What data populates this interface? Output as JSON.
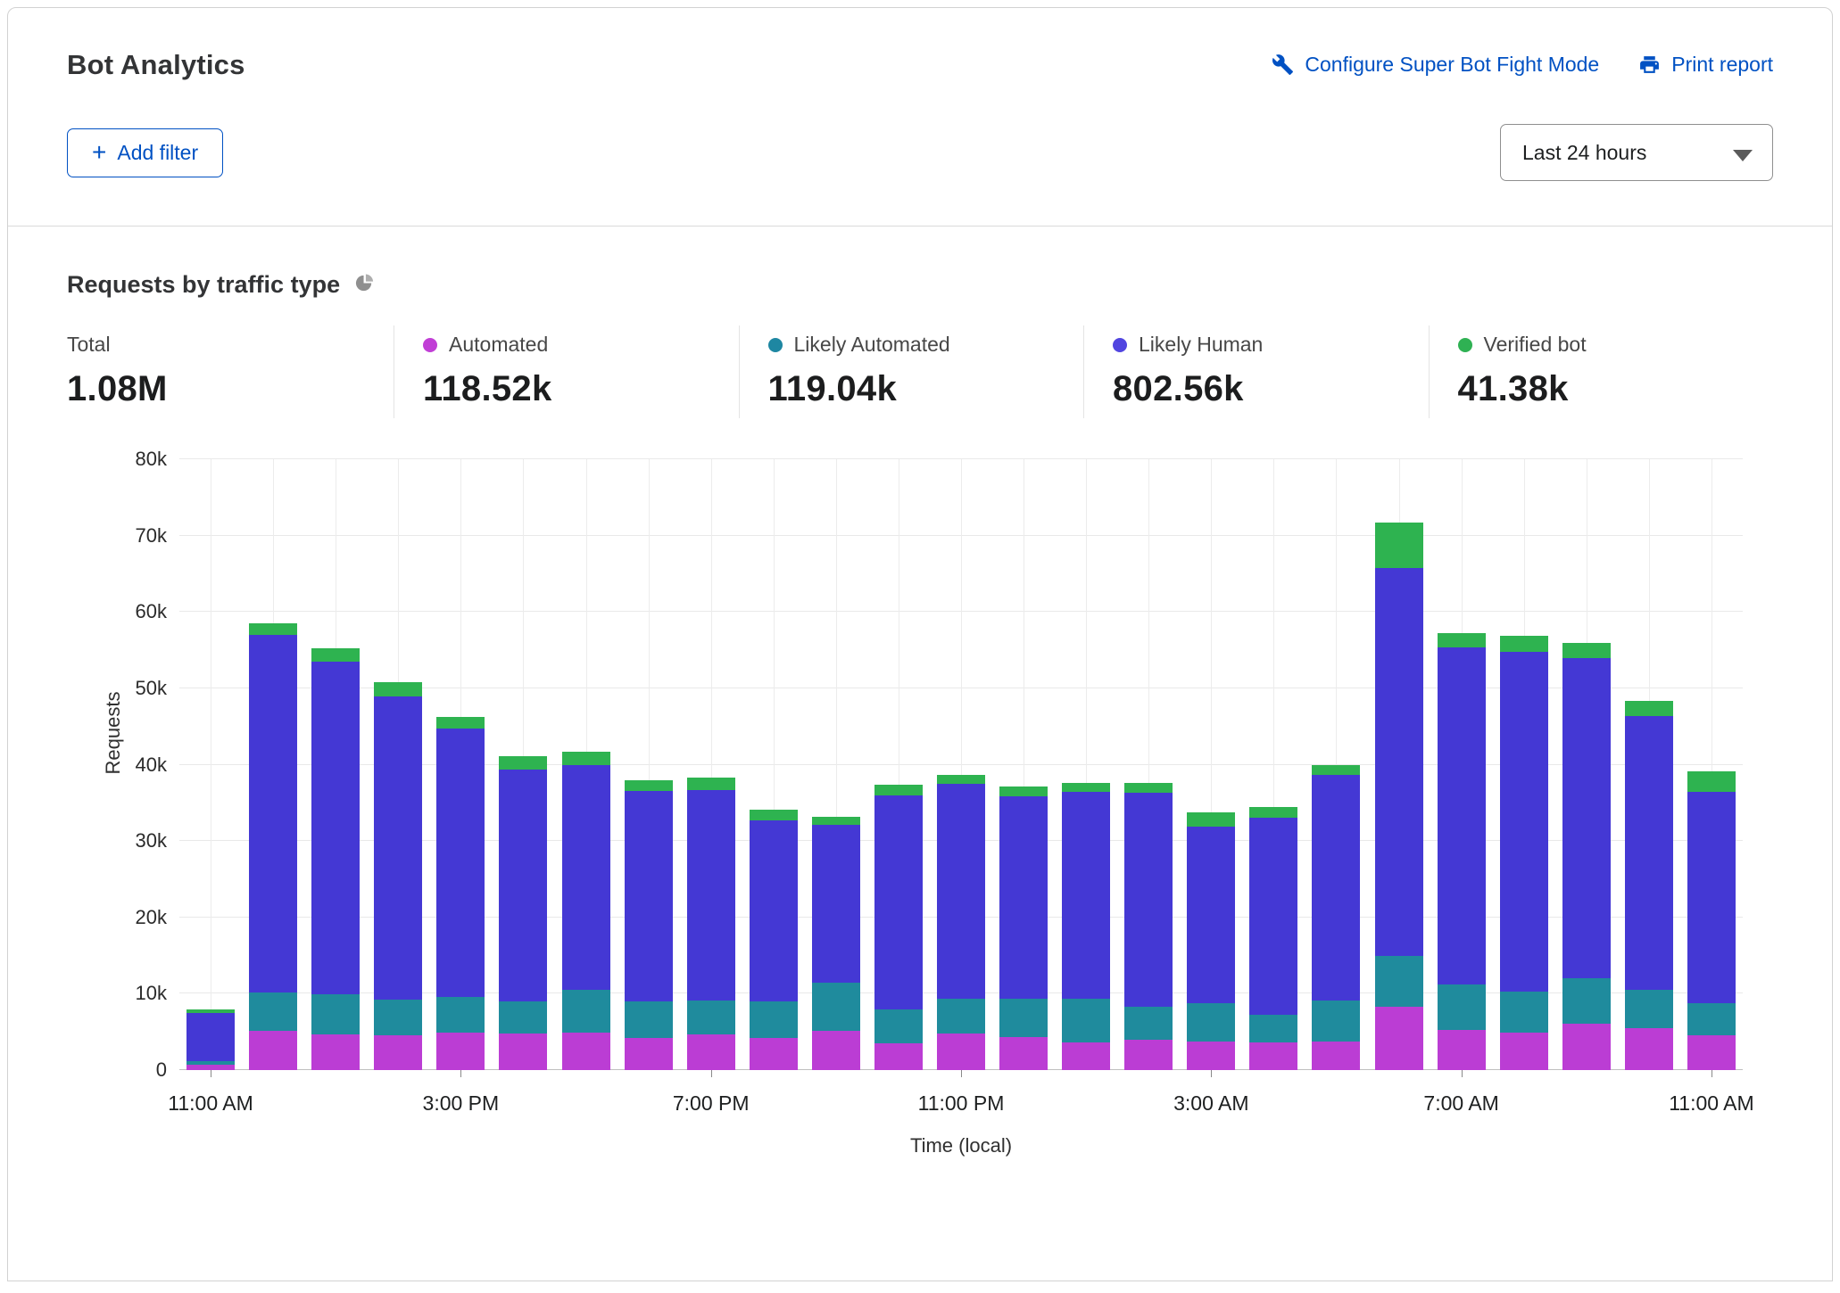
{
  "header": {
    "title": "Bot Analytics",
    "configure_link": "Configure Super Bot Fight Mode",
    "print_link": "Print report",
    "add_filter_plus": "+",
    "add_filter_label": "Add filter",
    "time_range_value": "Last 24 hours"
  },
  "section": {
    "title": "Requests by traffic type"
  },
  "stats": [
    {
      "label": "Total",
      "value": "1.08M",
      "color": ""
    },
    {
      "label": "Automated",
      "value": "118.52k",
      "color": "#c13fd6"
    },
    {
      "label": "Likely Automated",
      "value": "119.04k",
      "color": "#1e87a2"
    },
    {
      "label": "Likely Human",
      "value": "802.56k",
      "color": "#5145e0"
    },
    {
      "label": "Verified bot",
      "value": "41.38k",
      "color": "#2fb153"
    }
  ],
  "colors": {
    "link_blue": "#0051c3",
    "grid": "#e9e9e9",
    "axis": "#bfbfbf"
  },
  "chart_data": {
    "type": "bar",
    "stacked": true,
    "title": "Requests by traffic type",
    "xlabel": "Time (local)",
    "ylabel": "Requests",
    "ylim": [
      0,
      80000
    ],
    "grid": true,
    "legend_position": "top-stats-row",
    "y_ticks": [
      "0",
      "10k",
      "20k",
      "30k",
      "40k",
      "50k",
      "60k",
      "70k",
      "80k"
    ],
    "x_ticks": [
      {
        "index": 0,
        "label": "11:00 AM"
      },
      {
        "index": 4,
        "label": "3:00 PM"
      },
      {
        "index": 8,
        "label": "7:00 PM"
      },
      {
        "index": 12,
        "label": "11:00 PM"
      },
      {
        "index": 16,
        "label": "3:00 AM"
      },
      {
        "index": 20,
        "label": "7:00 AM"
      },
      {
        "index": 24,
        "label": "11:00 AM"
      }
    ],
    "categories": [
      "11:00 AM",
      "12:00 PM",
      "1:00 PM",
      "2:00 PM",
      "3:00 PM",
      "4:00 PM",
      "5:00 PM",
      "6:00 PM",
      "7:00 PM",
      "8:00 PM",
      "9:00 PM",
      "10:00 PM",
      "11:00 PM",
      "12:00 AM",
      "1:00 AM",
      "2:00 AM",
      "3:00 AM",
      "4:00 AM",
      "5:00 AM",
      "6:00 AM",
      "7:00 AM",
      "8:00 AM",
      "9:00 AM",
      "10:00 AM",
      "11:00 AM"
    ],
    "series": [
      {
        "name": "Automated",
        "color": "#bb3dd4",
        "values": [
          700,
          5100,
          4700,
          4600,
          4900,
          4800,
          4900,
          4200,
          4700,
          4200,
          5100,
          3500,
          4800,
          4300,
          3600,
          4000,
          3700,
          3600,
          3700,
          8300,
          5300,
          4900,
          6100,
          5500,
          4600
        ]
      },
      {
        "name": "Likely Automated",
        "color": "#1f8b9d",
        "values": [
          500,
          5100,
          5200,
          4600,
          4700,
          4200,
          5600,
          4800,
          4400,
          4800,
          6300,
          4500,
          4500,
          5100,
          5800,
          4300,
          5100,
          3700,
          5400,
          6600,
          5900,
          5400,
          5900,
          5000,
          4200
        ]
      },
      {
        "name": "Likely Human",
        "color": "#4438d4",
        "values": [
          6300,
          46800,
          43600,
          39700,
          35100,
          30400,
          29500,
          27500,
          27600,
          23700,
          20700,
          28000,
          28200,
          26500,
          27000,
          28000,
          23100,
          25700,
          29600,
          50900,
          44200,
          44500,
          42000,
          35900,
          27600
        ]
      },
      {
        "name": "Verified bot",
        "color": "#2eb350",
        "values": [
          400,
          1500,
          1800,
          1900,
          1500,
          1700,
          1700,
          1500,
          1600,
          1400,
          1100,
          1400,
          1200,
          1300,
          1200,
          1300,
          1900,
          1500,
          1300,
          5900,
          1800,
          2100,
          1900,
          2000,
          2700
        ]
      }
    ]
  }
}
